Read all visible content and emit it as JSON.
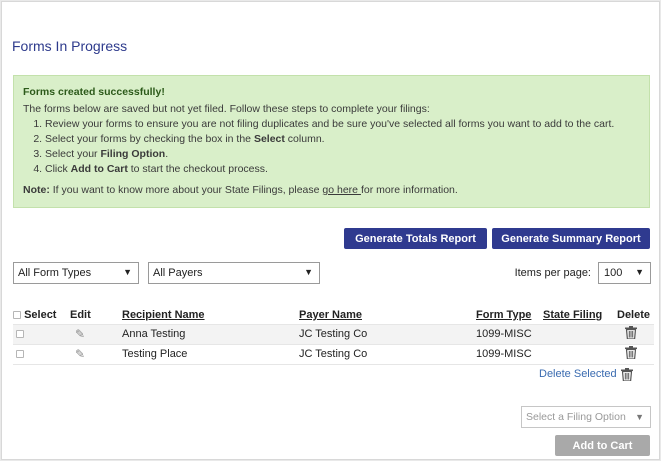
{
  "page": {
    "title": "Forms In Progress"
  },
  "alert": {
    "heading": "Forms created successfully!",
    "intro": "The forms below are saved but not yet filed. Follow these steps to complete your filings:",
    "steps": [
      {
        "pre": "Review your forms to ensure you are not filing duplicates and be sure you've selected all forms you want to add to the cart.",
        "bold": "",
        "post": ""
      },
      {
        "pre": "Select your forms by checking the box in the ",
        "bold": "Select",
        "post": " column."
      },
      {
        "pre": "Select your ",
        "bold": "Filing Option",
        "post": "."
      },
      {
        "pre": "Click ",
        "bold": "Add to Cart",
        "post": " to start the checkout process."
      }
    ],
    "note_label": "Note:",
    "note_text": " If you want to know more about your State Filings, please ",
    "note_link": "go here ",
    "note_tail": "for more information."
  },
  "actions": {
    "totals_report": "Generate Totals Report",
    "summary_report": "Generate Summary Report"
  },
  "filters": {
    "form_types": "All Form Types",
    "payers": "All Payers",
    "items_per_page_label": "Items per page:",
    "items_per_page": "100"
  },
  "table": {
    "headers": {
      "select": "Select",
      "edit": "Edit",
      "recipient": "Recipient Name",
      "payer": "Payer Name",
      "form_type": "Form Type",
      "state_filing": "State Filing",
      "delete": "Delete"
    },
    "rows": [
      {
        "recipient": "Anna Testing",
        "payer": "JC Testing Co",
        "form_type": "1099-MISC",
        "state_filing": ""
      },
      {
        "recipient": "Testing Place",
        "payer": "JC Testing Co",
        "form_type": "1099-MISC",
        "state_filing": ""
      }
    ]
  },
  "footer": {
    "delete_selected": "Delete Selected",
    "filing_option_placeholder": "Select a Filing Option",
    "add_to_cart": "Add to Cart"
  },
  "colors": {
    "primary_button": "#2f3a8f",
    "title": "#2d3a8c",
    "alert_bg": "#d9efc9",
    "link": "#3a6bb0",
    "disabled_button": "#a9a9a9"
  }
}
